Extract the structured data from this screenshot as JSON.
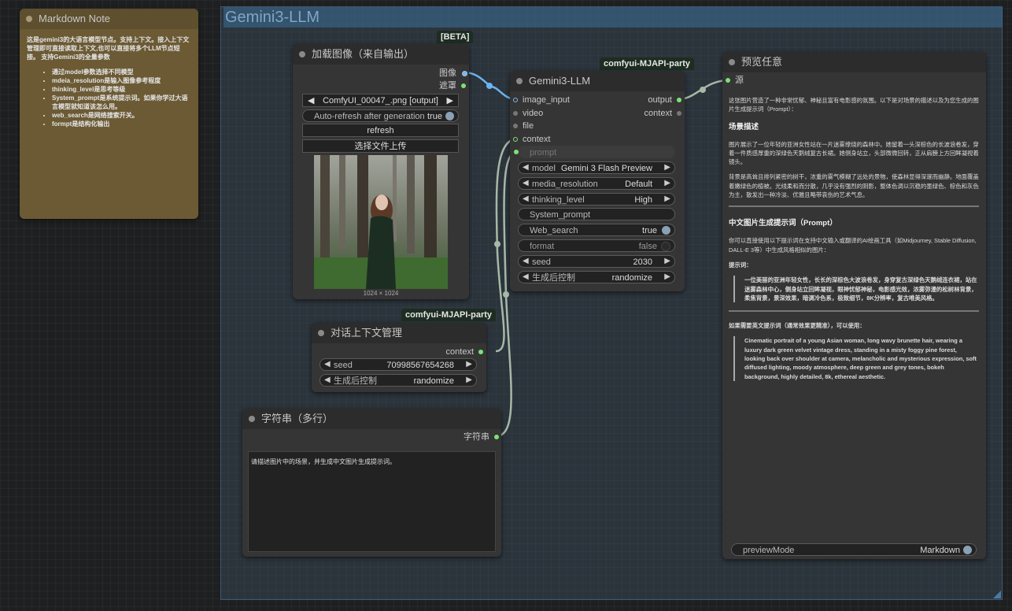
{
  "group": {
    "title": "Gemini3-LLM"
  },
  "markdown_note": {
    "title": "Markdown Note",
    "intro": "这是gemini3的大语言模型节点。支持上下文。接入上下文管理即可直接读取上下文,也可以直接将多个LLM节点短接。 支持Gemini3的全量参数",
    "bullets": [
      "通过model参数选择不同模型",
      "mdeia_resolution是输入图像参考程度",
      "thinking_level是思考等级",
      "System_prompt是系统提示词。如果你学过大语言模型就知道该怎么用。",
      "web_search是网络搜索开关。",
      "formpt是结构化输出"
    ]
  },
  "load_image": {
    "badge": "[BETA]",
    "title": "加载图像（来自输出）",
    "out_image": "图像",
    "out_mask": "遮罩",
    "file_value": "ComfyUI_00047_.png [output]",
    "auto_refresh_label": "Auto-refresh after generation",
    "auto_refresh_value": "true",
    "refresh_button": "refresh",
    "upload_button": "选择文件上传",
    "image_size": "1024 × 1024"
  },
  "gemini": {
    "badge": "comfyui-MJAPI-party",
    "title": "Gemini3-LLM",
    "inputs": [
      "image_input",
      "video",
      "file",
      "context"
    ],
    "out_output": "output",
    "out_context": "context",
    "prompt_placeholder": "prompt",
    "model_label": "model",
    "model_value": "Gemini 3 Flash Preview",
    "media_label": "media_resolution",
    "media_value": "Default",
    "thinking_label": "thinking_level",
    "thinking_value": "High",
    "system_prompt_label": "System_prompt",
    "web_search_label": "Web_search",
    "web_search_value": "true",
    "format_label": "format",
    "format_value": "false",
    "seed_label": "seed",
    "seed_value": "2030",
    "gen_label": "生成后控制",
    "gen_value": "randomize"
  },
  "context_node": {
    "badge": "comfyui-MJAPI-party",
    "title": "对话上下文管理",
    "out_context": "context",
    "seed_label": "seed",
    "seed_value": "70998567654268",
    "gen_label": "生成后控制",
    "gen_value": "randomize"
  },
  "string_node": {
    "title": "字符串（多行）",
    "out_label": "字符串",
    "text": "请描述图片中的场景，并生成中文图片生成提示词。"
  },
  "preview": {
    "title": "预览任意",
    "in_label": "源",
    "intro": "这张图片营造了一种非常忧郁、神秘且富有电影感的氛围。以下是对场景的描述以及为您生成的图片生成提示词（Prompt）：",
    "h_scene": "场景描述",
    "p_scene1": "图片展示了一位年轻的亚洲女性站在一片迷雾缭绕的森林中。她留着一头深棕色的长波浪卷发，穿着一件质感厚重的深绿色天鹅绒复古长裙。她侧身站立，头部微微回转，正从肩膀上方回眸凝视着镜头。",
    "p_scene2": "背景是高耸且排列紧密的树干，浓重的雾气模糊了远处的景物，使森林显得深邃而幽静。地面覆盖着嫩绿色的植被。光线柔和而分散，几乎没有强烈的阴影，整体色调以沉稳的墨绿色、棕色和灰色为主，散发出一种冷淡、优雅且略带哀伤的艺术气息。",
    "h_prompt": "中文图片生成提示词（Prompt）",
    "p_prompt": "你可以直接使用以下提示词在支持中文输入或翻译的AI绘画工具（如Midjourney, Stable Diffusion, DALL-E 3等）中生成风格相似的图片：",
    "label_prompt": "提示词：",
    "quote_cn": "一位美丽的亚洲年轻女性，长长的深棕色大波浪卷发，身穿复古深绿色天鹅绒连衣裙，站在迷雾森林中心，侧身站立回眸凝视，眼神忧郁神秘，电影感光效，浓雾弥漫的松树林背景，柔焦背景，景深效果，暗调冷色系，极致细节，8K分辨率，复古唯美风格。",
    "label_en": "如果需要英文提示词（通常效果更精准），可以使用：",
    "quote_en": "Cinematic portrait of a young Asian woman, long wavy brunette hair, wearing a luxury dark green velvet vintage dress, standing in a misty foggy pine forest, looking back over shoulder at camera, melancholic and mysterious expression, soft diffused lighting, moody atmosphere, deep green and grey tones, bokeh background, highly detailed, 8k, ethereal aesthetic.",
    "preview_mode_label": "previewMode",
    "preview_mode_value": "Markdown"
  },
  "colors": {
    "link_blue": "#6cb4ee",
    "link_gray": "#9db39d",
    "port_green": "#7de07a",
    "note_bg": "#6b5a34"
  }
}
